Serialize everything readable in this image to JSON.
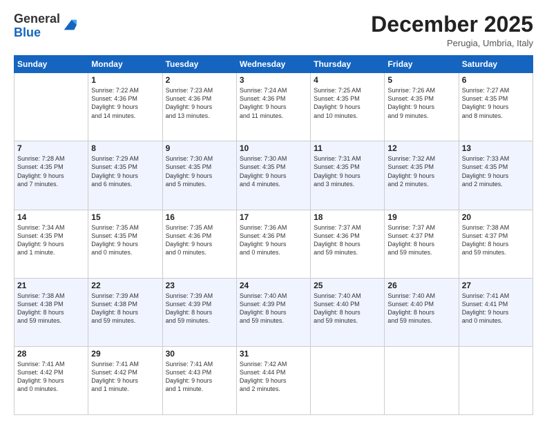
{
  "logo": {
    "line1": "General",
    "line2": "Blue"
  },
  "title": "December 2025",
  "subtitle": "Perugia, Umbria, Italy",
  "days_of_week": [
    "Sunday",
    "Monday",
    "Tuesday",
    "Wednesday",
    "Thursday",
    "Friday",
    "Saturday"
  ],
  "weeks": [
    [
      {
        "day": "",
        "info": ""
      },
      {
        "day": "1",
        "info": "Sunrise: 7:22 AM\nSunset: 4:36 PM\nDaylight: 9 hours\nand 14 minutes."
      },
      {
        "day": "2",
        "info": "Sunrise: 7:23 AM\nSunset: 4:36 PM\nDaylight: 9 hours\nand 13 minutes."
      },
      {
        "day": "3",
        "info": "Sunrise: 7:24 AM\nSunset: 4:36 PM\nDaylight: 9 hours\nand 11 minutes."
      },
      {
        "day": "4",
        "info": "Sunrise: 7:25 AM\nSunset: 4:35 PM\nDaylight: 9 hours\nand 10 minutes."
      },
      {
        "day": "5",
        "info": "Sunrise: 7:26 AM\nSunset: 4:35 PM\nDaylight: 9 hours\nand 9 minutes."
      },
      {
        "day": "6",
        "info": "Sunrise: 7:27 AM\nSunset: 4:35 PM\nDaylight: 9 hours\nand 8 minutes."
      }
    ],
    [
      {
        "day": "7",
        "info": "Sunrise: 7:28 AM\nSunset: 4:35 PM\nDaylight: 9 hours\nand 7 minutes."
      },
      {
        "day": "8",
        "info": "Sunrise: 7:29 AM\nSunset: 4:35 PM\nDaylight: 9 hours\nand 6 minutes."
      },
      {
        "day": "9",
        "info": "Sunrise: 7:30 AM\nSunset: 4:35 PM\nDaylight: 9 hours\nand 5 minutes."
      },
      {
        "day": "10",
        "info": "Sunrise: 7:30 AM\nSunset: 4:35 PM\nDaylight: 9 hours\nand 4 minutes."
      },
      {
        "day": "11",
        "info": "Sunrise: 7:31 AM\nSunset: 4:35 PM\nDaylight: 9 hours\nand 3 minutes."
      },
      {
        "day": "12",
        "info": "Sunrise: 7:32 AM\nSunset: 4:35 PM\nDaylight: 9 hours\nand 2 minutes."
      },
      {
        "day": "13",
        "info": "Sunrise: 7:33 AM\nSunset: 4:35 PM\nDaylight: 9 hours\nand 2 minutes."
      }
    ],
    [
      {
        "day": "14",
        "info": "Sunrise: 7:34 AM\nSunset: 4:35 PM\nDaylight: 9 hours\nand 1 minute."
      },
      {
        "day": "15",
        "info": "Sunrise: 7:35 AM\nSunset: 4:35 PM\nDaylight: 9 hours\nand 0 minutes."
      },
      {
        "day": "16",
        "info": "Sunrise: 7:35 AM\nSunset: 4:36 PM\nDaylight: 9 hours\nand 0 minutes."
      },
      {
        "day": "17",
        "info": "Sunrise: 7:36 AM\nSunset: 4:36 PM\nDaylight: 9 hours\nand 0 minutes."
      },
      {
        "day": "18",
        "info": "Sunrise: 7:37 AM\nSunset: 4:36 PM\nDaylight: 8 hours\nand 59 minutes."
      },
      {
        "day": "19",
        "info": "Sunrise: 7:37 AM\nSunset: 4:37 PM\nDaylight: 8 hours\nand 59 minutes."
      },
      {
        "day": "20",
        "info": "Sunrise: 7:38 AM\nSunset: 4:37 PM\nDaylight: 8 hours\nand 59 minutes."
      }
    ],
    [
      {
        "day": "21",
        "info": "Sunrise: 7:38 AM\nSunset: 4:38 PM\nDaylight: 8 hours\nand 59 minutes."
      },
      {
        "day": "22",
        "info": "Sunrise: 7:39 AM\nSunset: 4:38 PM\nDaylight: 8 hours\nand 59 minutes."
      },
      {
        "day": "23",
        "info": "Sunrise: 7:39 AM\nSunset: 4:39 PM\nDaylight: 8 hours\nand 59 minutes."
      },
      {
        "day": "24",
        "info": "Sunrise: 7:40 AM\nSunset: 4:39 PM\nDaylight: 8 hours\nand 59 minutes."
      },
      {
        "day": "25",
        "info": "Sunrise: 7:40 AM\nSunset: 4:40 PM\nDaylight: 8 hours\nand 59 minutes."
      },
      {
        "day": "26",
        "info": "Sunrise: 7:40 AM\nSunset: 4:40 PM\nDaylight: 8 hours\nand 59 minutes."
      },
      {
        "day": "27",
        "info": "Sunrise: 7:41 AM\nSunset: 4:41 PM\nDaylight: 9 hours\nand 0 minutes."
      }
    ],
    [
      {
        "day": "28",
        "info": "Sunrise: 7:41 AM\nSunset: 4:42 PM\nDaylight: 9 hours\nand 0 minutes."
      },
      {
        "day": "29",
        "info": "Sunrise: 7:41 AM\nSunset: 4:42 PM\nDaylight: 9 hours\nand 1 minute."
      },
      {
        "day": "30",
        "info": "Sunrise: 7:41 AM\nSunset: 4:43 PM\nDaylight: 9 hours\nand 1 minute."
      },
      {
        "day": "31",
        "info": "Sunrise: 7:42 AM\nSunset: 4:44 PM\nDaylight: 9 hours\nand 2 minutes."
      },
      {
        "day": "",
        "info": ""
      },
      {
        "day": "",
        "info": ""
      },
      {
        "day": "",
        "info": ""
      }
    ]
  ]
}
